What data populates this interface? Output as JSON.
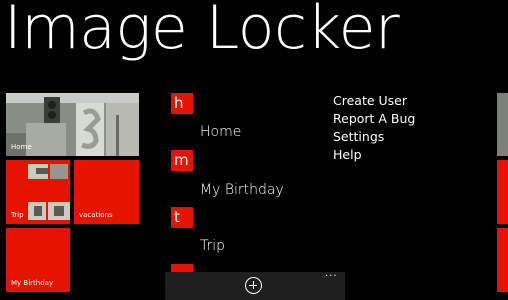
{
  "app": {
    "title": "Image Locker"
  },
  "tiles": [
    {
      "label": "Home"
    },
    {
      "label": "Trip"
    },
    {
      "label": "vacations"
    },
    {
      "label": "My Birthday"
    }
  ],
  "albums": [
    {
      "letter": "h",
      "name": "Home"
    },
    {
      "letter": "m",
      "name": "My Birthday"
    },
    {
      "letter": "t",
      "name": "Trip"
    }
  ],
  "menu": {
    "items": [
      "Create User",
      "Report A Bug",
      "Settings",
      "Help"
    ]
  },
  "app_bar": {
    "add_icon": "add-circle-icon",
    "more_label": "...",
    "colors": {
      "background": "#1f1f1f"
    }
  },
  "colors": {
    "accent": "#e51400",
    "background": "#000000",
    "text": "#ffffff"
  }
}
